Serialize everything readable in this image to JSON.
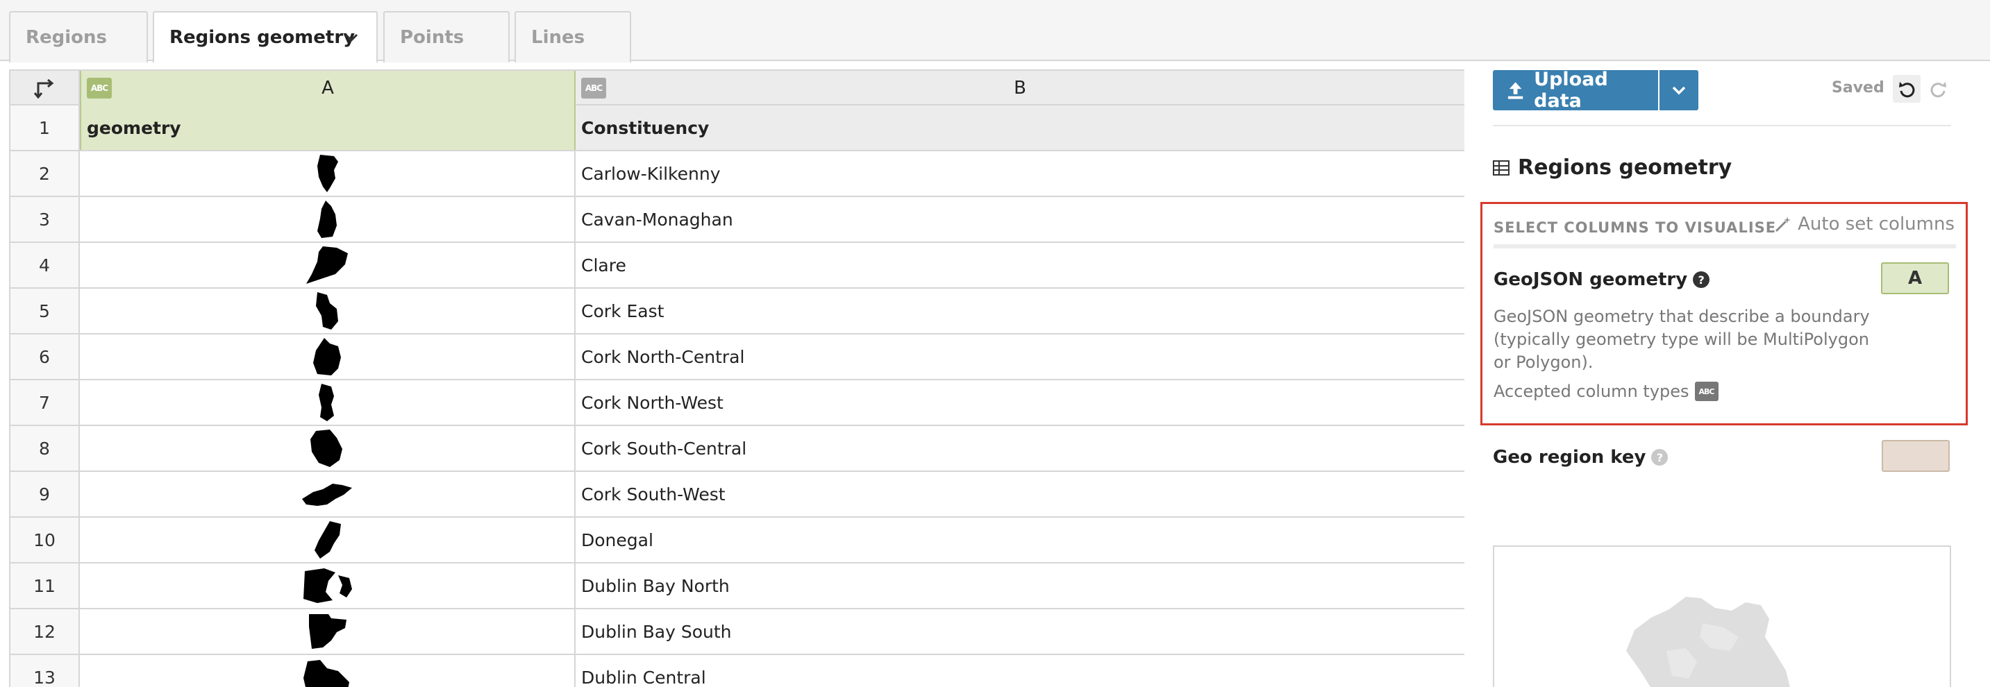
{
  "tabs": [
    {
      "label": "Regions",
      "active": false
    },
    {
      "label": "Regions geometry",
      "active": true
    },
    {
      "label": "Points",
      "active": false
    },
    {
      "label": "Lines",
      "active": false
    }
  ],
  "grid": {
    "type_badge": "ABC",
    "columns": [
      {
        "letter": "A",
        "type": "ABC",
        "selected": true
      },
      {
        "letter": "B",
        "type": "ABC",
        "selected": false
      }
    ],
    "header_row": {
      "num": "1",
      "a": "geometry",
      "b": "Constituency"
    },
    "rows": [
      {
        "num": "2",
        "b": "Carlow-Kilkenny"
      },
      {
        "num": "3",
        "b": "Cavan-Monaghan"
      },
      {
        "num": "4",
        "b": "Clare"
      },
      {
        "num": "5",
        "b": "Cork East"
      },
      {
        "num": "6",
        "b": "Cork North-Central"
      },
      {
        "num": "7",
        "b": "Cork North-West"
      },
      {
        "num": "8",
        "b": "Cork South-Central"
      },
      {
        "num": "9",
        "b": "Cork South-West"
      },
      {
        "num": "10",
        "b": "Donegal"
      },
      {
        "num": "11",
        "b": "Dublin Bay North"
      },
      {
        "num": "12",
        "b": "Dublin Bay South"
      },
      {
        "num": "13",
        "b": "Dublin Central"
      }
    ]
  },
  "panel": {
    "upload_label": "Upload data",
    "saved_label": "Saved",
    "dataset_title": "Regions geometry",
    "select_header": "SELECT COLUMNS TO VISUALISE",
    "auto_set_label": "Auto set columns",
    "geojson": {
      "label": "GeoJSON geometry",
      "help": "?",
      "value": "A",
      "description": "GeoJSON geometry that describe a boundary (typically geometry type will be MultiPolygon or Polygon).",
      "accepted_label": "Accepted column types",
      "accepted_badge": "ABC"
    },
    "region_key": {
      "label": "Geo region key",
      "help": "?"
    }
  },
  "colors": {
    "accent": "#3a80b0",
    "selected_column": "#dfe8c9",
    "highlight_border": "#d73a2e"
  }
}
